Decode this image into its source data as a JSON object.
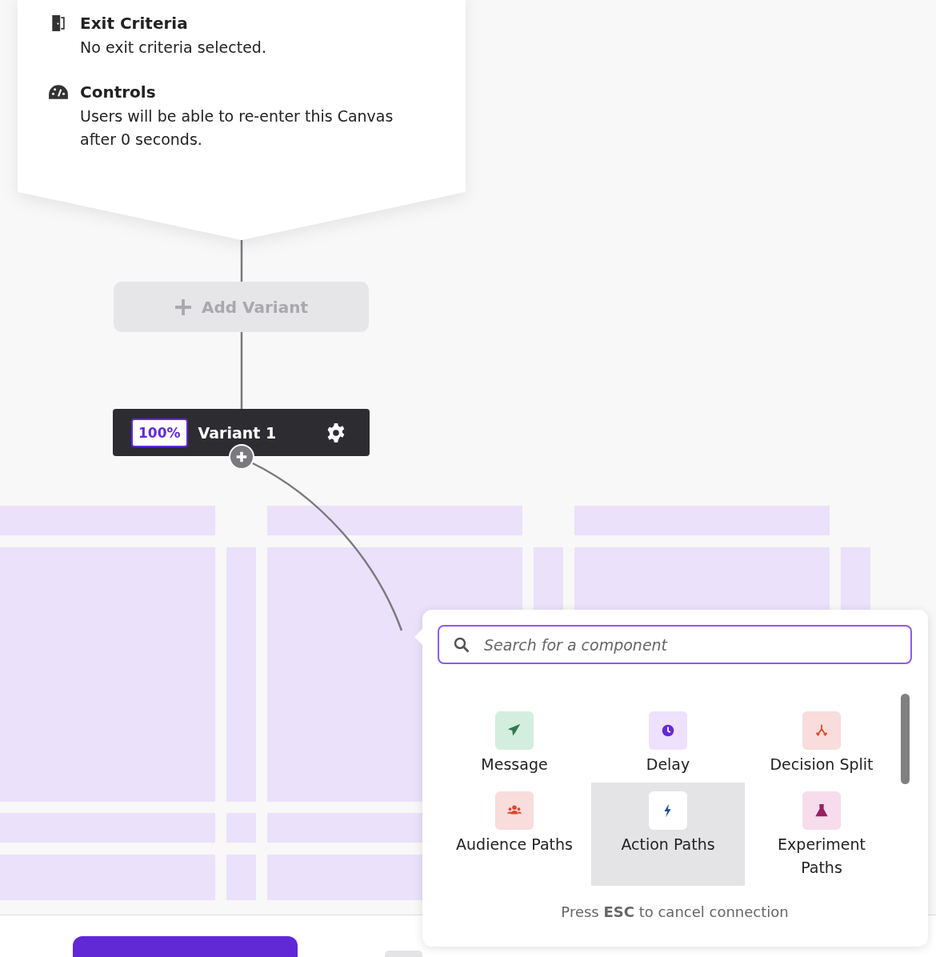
{
  "entry_card": {
    "sections": [
      {
        "kind": "exit",
        "title": "Exit Criteria",
        "text": "No exit criteria selected."
      },
      {
        "kind": "controls",
        "title": "Controls",
        "text": "Users will be able to re-enter this Canvas after 0 seconds."
      }
    ]
  },
  "add_variant": {
    "label": "Add Variant",
    "disabled": true
  },
  "variant": {
    "percent": "100%",
    "name": "Variant 1"
  },
  "component_picker": {
    "search": {
      "placeholder": "Search for a component"
    },
    "components": [
      {
        "kind": "message",
        "label": "Message",
        "selected": false
      },
      {
        "kind": "delay",
        "label": "Delay",
        "selected": false
      },
      {
        "kind": "decision",
        "label": "Decision Split",
        "selected": false
      },
      {
        "kind": "audience",
        "label": "Audience Paths",
        "selected": false
      },
      {
        "kind": "action",
        "label": "Action Paths",
        "selected": true
      },
      {
        "kind": "experiment",
        "label": "Experiment Paths",
        "selected": false
      }
    ],
    "hint": "Press **ESC** to cancel connection"
  }
}
